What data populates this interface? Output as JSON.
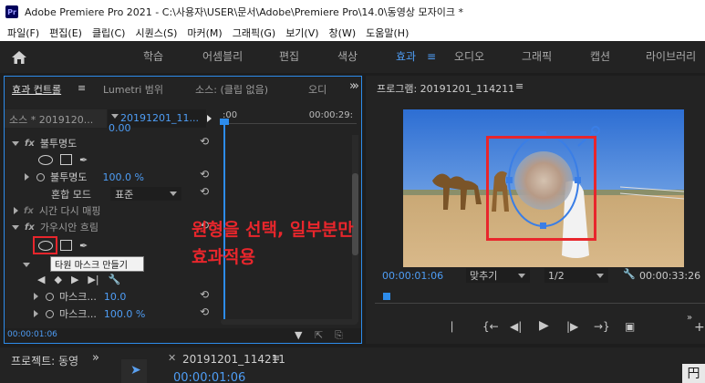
{
  "window": {
    "app_badge": "Pr",
    "title": "Adobe Premiere Pro 2021 - C:\\사용자\\USER\\문서\\Adobe\\Premiere Pro\\14.0\\동영상 모자이크 *"
  },
  "menu": [
    "파일(F)",
    "편집(E)",
    "클립(C)",
    "시퀀스(S)",
    "마커(M)",
    "그래픽(G)",
    "보기(V)",
    "창(W)",
    "도움말(H)"
  ],
  "workspaces": [
    "학습",
    "어셈블리",
    "편집",
    "색상",
    "효과",
    "오디오",
    "그래픽",
    "캡션",
    "라이브러리"
  ],
  "effect_controls": {
    "tabs": [
      "효과 컨트롤",
      "Lumetri 범위",
      "소스: (클립 없음)",
      "오디"
    ],
    "source_clip": "소스 * 2019120...",
    "sequence_clip": "20191201_11...",
    "time_ruler_start": ":00",
    "time_ruler_end": "00:00:29:",
    "row_partial_value": "0.00",
    "opacity_label": "불투명도",
    "opacity_sub_label": "불투명도",
    "opacity_value": "100.0 %",
    "blend_mode_label": "혼합 모드",
    "blend_mode_value": "표준",
    "time_remap_label": "시간 다시 매핑",
    "gaussian_blur_label": "가우시안 흐림",
    "tooltip": "타원 마스크 만들기",
    "mask_row_label": "마스크...",
    "mask_feather_value": "10.0",
    "mask_opacity_value": "100.0 %",
    "timecode": "00:00:01:06"
  },
  "program_monitor": {
    "title": "프로그램: 20191201_114211",
    "current_timecode": "00:00:01:06",
    "fit": "맞추기",
    "resolution": "1/2",
    "duration": "00:00:33:26"
  },
  "annotation": {
    "line1": "원형을 선택, 일부분만",
    "line2": "효과적용"
  },
  "bottom": {
    "project_tab": "프로젝트: 동영",
    "timeline_tab": "20191201_114211",
    "timeline_timecode": "00:00:01:06",
    "corner_text": "円"
  },
  "colors": {
    "accent": "#2d8ceb",
    "annotation_red": "#e8262c",
    "panel_bg": "#232323"
  }
}
